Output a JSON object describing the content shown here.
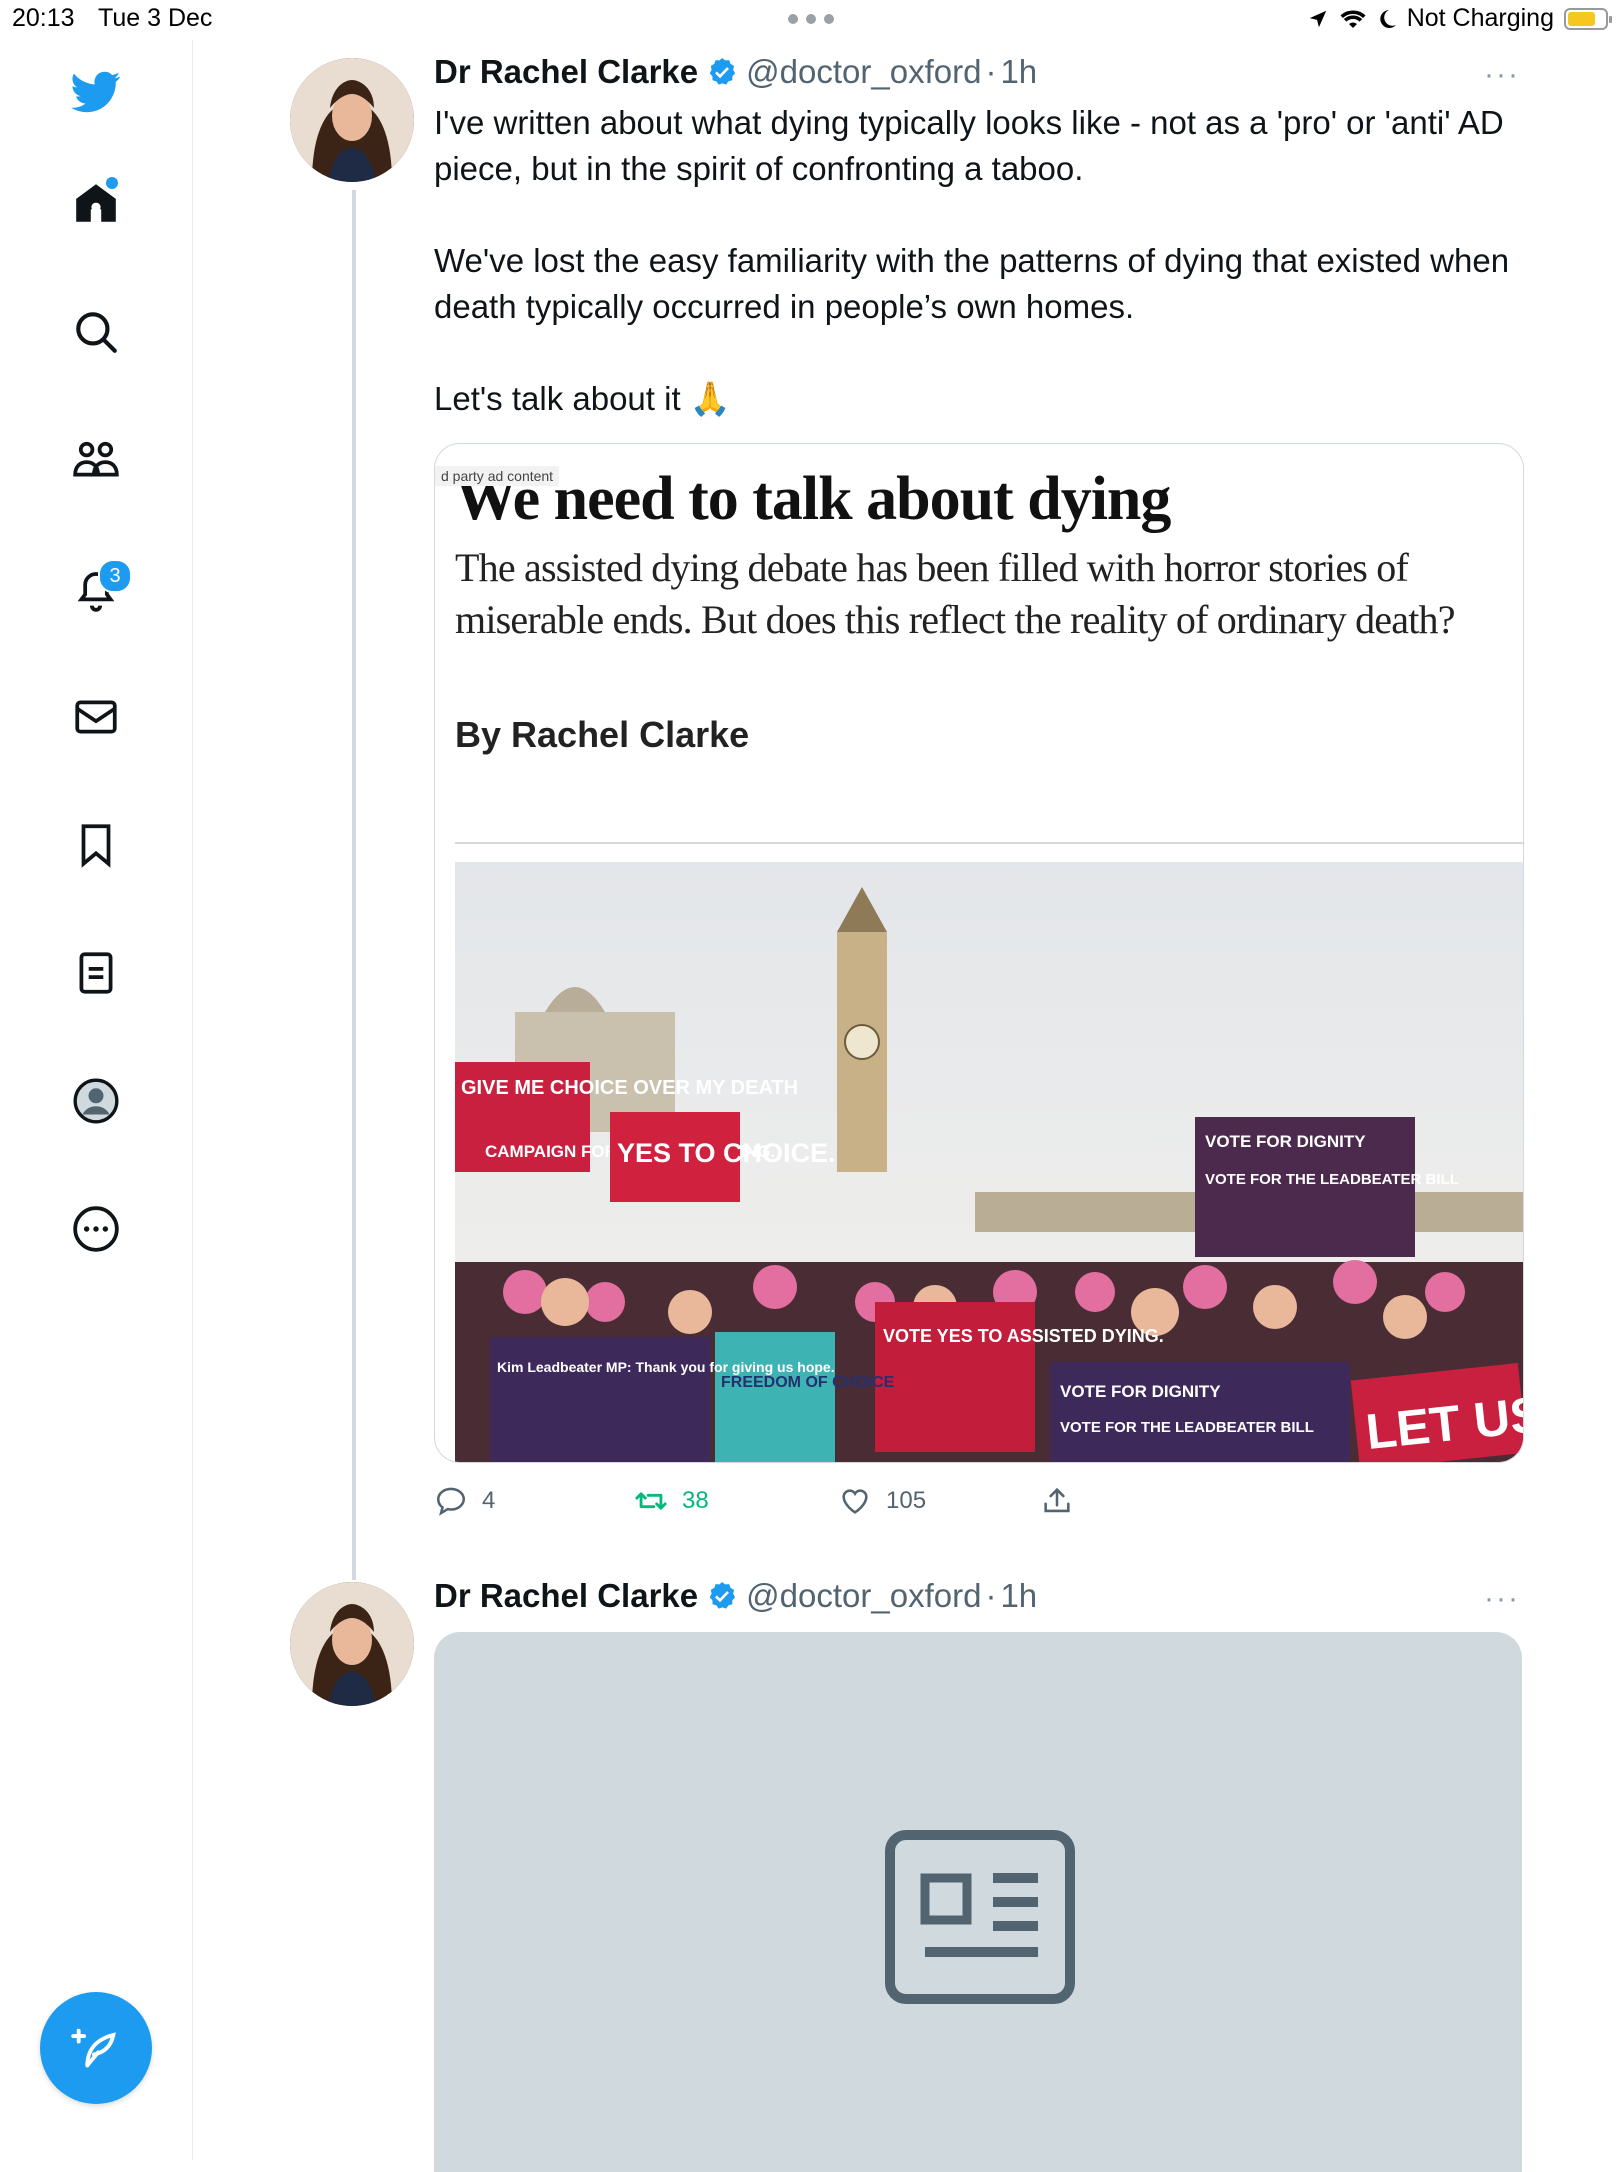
{
  "status_bar": {
    "time": "20:13",
    "date": "Tue 3 Dec",
    "charging": "Not Charging",
    "battery_level": 0.75
  },
  "sidebar": {
    "items": [
      {
        "icon": "twitter-logo-icon"
      },
      {
        "icon": "home-icon"
      },
      {
        "icon": "search-icon"
      },
      {
        "icon": "communities-icon"
      },
      {
        "icon": "bell-icon",
        "badge": "3"
      },
      {
        "icon": "mail-icon"
      },
      {
        "icon": "bookmark-icon"
      },
      {
        "icon": "lists-icon"
      },
      {
        "icon": "profile-icon"
      },
      {
        "icon": "more-icon"
      }
    ],
    "compose_icon": "compose-icon"
  },
  "colors": {
    "accent": "#1d9bf0",
    "retweet_active": "#00ba7c",
    "text_primary": "#0f1419",
    "text_secondary": "#536471"
  },
  "tweet1": {
    "name": "Dr Rachel Clarke",
    "handle": "@doctor_oxford",
    "separator": "·",
    "time": "1h",
    "more": "···",
    "text": {
      "p1": "I've written about what dying typically looks like - not as a 'pro' or 'anti' AD piece, but in the spirit of confronting a taboo.",
      "p2": "We've lost the easy familiarity with the patterns of dying that existed when death typically occurred in people’s own homes.",
      "p3": "Let's talk about it 🙏"
    },
    "card": {
      "ad_label": "d party ad content",
      "headline": "We need to talk about dying",
      "standfirst": "The assisted dying debate has been filled with horror stories of miserable ends. But does this reflect the reality of ordinary death?",
      "byline": "By Rachel Clarke",
      "photo_signs": {
        "sign1": "GIVE ME CHOICE OVER MY DEATH",
        "sign2": "YES TO CHOICE.",
        "sign3": "VOTE FOR DIGNITY",
        "sign4": "VOTE FOR THE LEADBEATER BILL",
        "sign5": "VOTE YES TO ASSISTED DYING.",
        "sign6": "FREEDOM OF CHOICE",
        "sign7": "Kim Leadbeater MP: Thank you for giving us hope.",
        "sign8": "CAMPAIGN FOR DIGNITY IN DYING.",
        "sign9": "LET US"
      }
    },
    "actions": {
      "replies": "4",
      "retweets": "38",
      "likes": "105"
    }
  },
  "tweet2": {
    "name": "Dr Rachel Clarke",
    "handle": "@doctor_oxford",
    "separator": "·",
    "time": "1h",
    "more": "···",
    "media_icon": "article-placeholder-icon"
  }
}
